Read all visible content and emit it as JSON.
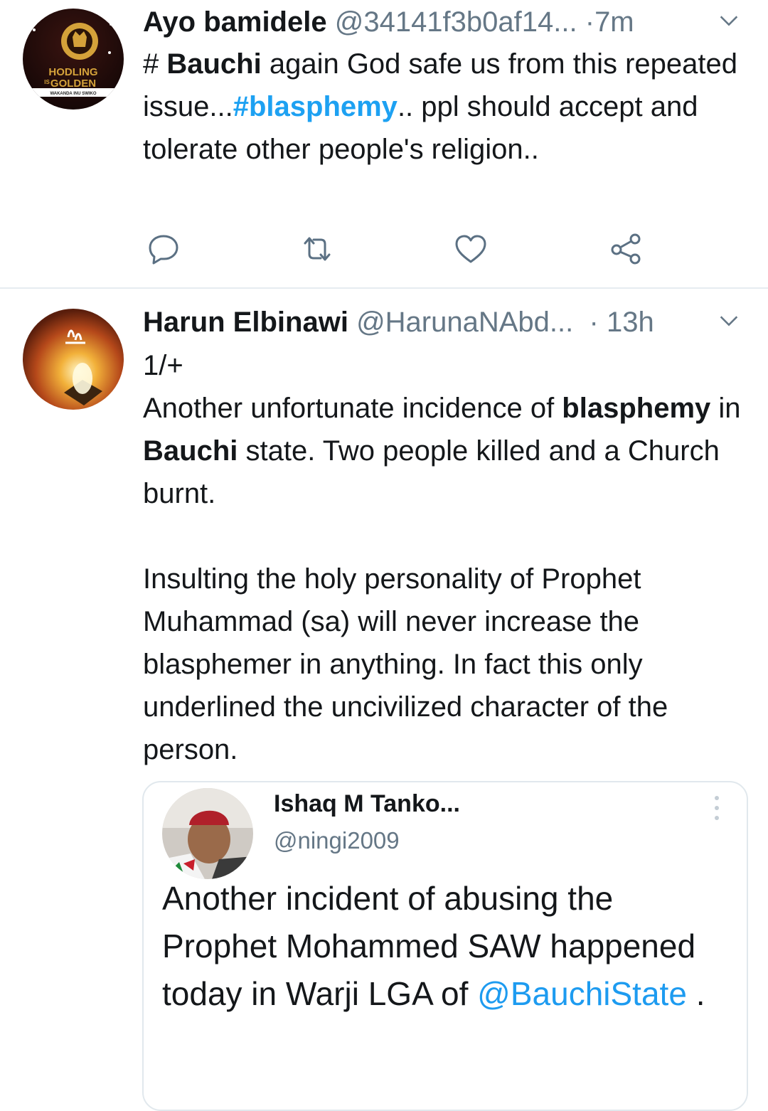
{
  "tweets": [
    {
      "author_name": "Ayo bamidele",
      "handle": "@34141f3b0af14...",
      "separator": "·",
      "time": "7m",
      "avatar_text": {
        "line1": "HODLING",
        "line2": "IS",
        "line3": "GOLDEN",
        "banner": "WAKANDA INU SWIKO"
      },
      "text": {
        "p1": "# ",
        "p2": "Bauchi",
        "p3": " again God safe us from this repeated issue...",
        "p4": "#blasphemy",
        "p5": ".. ppl should accept and tolerate other people's religion.."
      }
    },
    {
      "author_name": "Harun Elbinawi",
      "handle": "@HarunaNAbd...",
      "separator": "·",
      "time": "13h",
      "text": {
        "l1": "1/+",
        "p1": "Another unfortunate incidence of ",
        "p2": "blasphemy",
        "p3": " in ",
        "p4": "Bauchi",
        "p5": " state. Two people killed and a Church burnt.",
        "para2": "Insulting the holy personality of Prophet Muhammad (sa) will never increase the blasphemer in anything. In fact this only underlined the uncivilized character of the person."
      },
      "quoted": {
        "name": "Ishaq M Tanko...",
        "handle": "@ningi2009",
        "text": "Another incident of abusing the Prophet Mohammed SAW happened today in Warji LGA of ",
        "mention": "@BauchiState",
        "end": " ."
      }
    }
  ],
  "actions": [
    "reply-icon",
    "retweet-icon",
    "like-icon",
    "share-icon"
  ],
  "colors": {
    "hashtag": "#1da1f2",
    "secondary_text": "#657786",
    "icon": "#5b7083",
    "divider": "#e6ecf0"
  }
}
